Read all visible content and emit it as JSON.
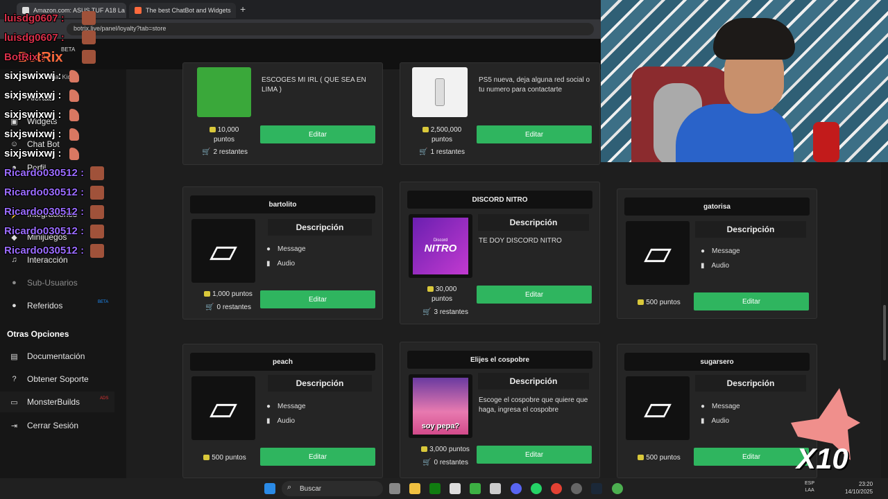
{
  "browser": {
    "tabs": [
      {
        "label": "Amazon.com: ASUS TUF A18 La"
      },
      {
        "label": "The best ChatBot and Widgets"
      }
    ],
    "new_tab": "+",
    "url": "botrix.live/panel/loyalty?tab=store"
  },
  "app": {
    "logo": "BotRix",
    "beta": "BETA"
  },
  "sidebar": {
    "items": [
      {
        "label": "Alertas"
      },
      {
        "label": "Widgets"
      },
      {
        "label": "Chat Bot"
      },
      {
        "label": "Perfil"
      },
      {
        "label": "Integraciones"
      },
      {
        "label": "Minijuegos"
      },
      {
        "label": "Interacción"
      },
      {
        "label": "Sub-Usuarios"
      },
      {
        "label": "Referidos",
        "badge": "BETA"
      }
    ],
    "section_title": "Otras Opciones",
    "other": [
      {
        "label": "Documentación"
      },
      {
        "label": "Obtener Soporte"
      },
      {
        "label": "MonsterBuilds",
        "badge": "ADS"
      },
      {
        "label": "Cerrar Sesión"
      }
    ]
  },
  "chat": {
    "lines": [
      {
        "user": "luisdg0607 :",
        "color": "red"
      },
      {
        "user": "luisdg0607 :",
        "color": "red"
      },
      {
        "user": "BotRix :",
        "color": "red"
      },
      {
        "user": "sixjswixwj :",
        "color": "white"
      },
      {
        "user": "sixjswixwj :",
        "color": "white"
      },
      {
        "user": "sixjswixwj :",
        "color": "white"
      },
      {
        "user": "sixjswixwj :",
        "color": "white"
      },
      {
        "user": "sixjswixwj :",
        "color": "white"
      },
      {
        "user": "Ricardo030512 :",
        "color": "purple"
      },
      {
        "user": "Ricardo030512 :",
        "color": "purple"
      },
      {
        "user": "Ricardo030512 :",
        "color": "purple"
      },
      {
        "user": "Ricardo030512 :",
        "color": "purple"
      },
      {
        "user": "Ricardo030512 :",
        "color": "purple"
      }
    ],
    "kick_fragment": "ma: Kick"
  },
  "store": {
    "desc_label": "Descripción",
    "edit_label": "Editar",
    "features": {
      "message": "Message",
      "audio": "Audio"
    },
    "cards": [
      {
        "description": "ESCOGES MI IRL ( QUE SEA EN LIMA )",
        "price": "10,000",
        "unit": "puntos",
        "stock": "2 restantes"
      },
      {
        "description": "PS5 nueva, deja alguna red social o tu numero para contactarte",
        "price": "2,500,000",
        "unit": "puntos",
        "stock": "1 restantes"
      },
      {
        "title": "bartolito",
        "price": "1,000 puntos",
        "stock": "0 restantes"
      },
      {
        "title": "DISCORD NITRO",
        "description": "TE DOY DISCORD NITRO",
        "price": "30,000",
        "unit": "puntos",
        "stock": "3 restantes",
        "image_text": "NITRO",
        "image_small": "Discord"
      },
      {
        "title": "gatorisa",
        "price": "500 puntos"
      },
      {
        "title": "peach",
        "price": "500 puntos"
      },
      {
        "title": "Elijes el cospobre",
        "description": "Escoge el cospobre que quiere que haga, ingresa el cospobre",
        "price": "3,000 puntos",
        "stock": "0 restantes",
        "image_text": "soy pepa?"
      },
      {
        "title": "sugarsero",
        "price": "500 puntos"
      }
    ]
  },
  "overlay": {
    "multiplier": "X10"
  },
  "taskbar": {
    "search": "Buscar",
    "lang": "ESP",
    "lang2": "LAA",
    "time": "23:20",
    "date": "14/10/2025"
  },
  "colors": {
    "accent": "#2fb55f",
    "logo": "#ff6a3d"
  }
}
